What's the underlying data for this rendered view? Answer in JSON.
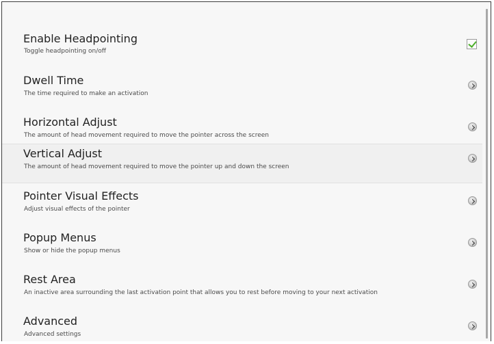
{
  "settings": {
    "items": [
      {
        "title": "Enable Headpointing",
        "summary": "Toggle headpointing on/off",
        "control": "checkbox",
        "checked": true
      },
      {
        "title": "Dwell Time",
        "summary": "The time required to make an activation",
        "control": "chevron-right-icon"
      },
      {
        "title": "Horizontal Adjust",
        "summary": "The amount of head movement required to move the pointer across the screen",
        "control": "chevron-right-icon"
      },
      {
        "title": "Vertical Adjust",
        "summary": "The amount of head movement required to move the pointer up and down the screen",
        "control": "chevron-right-icon"
      },
      {
        "title": "Pointer Visual Effects",
        "summary": "Adjust visual effects of the pointer",
        "control": "chevron-right-icon"
      },
      {
        "title": "Popup Menus",
        "summary": "Show or hide the popup menus",
        "control": "chevron-right-icon"
      },
      {
        "title": "Rest Area",
        "summary": "An inactive area surrounding the last activation point that allows you to rest before moving to your next activation",
        "control": "chevron-right-icon"
      },
      {
        "title": "Advanced",
        "summary": "Advanced settings",
        "control": "chevron-right-icon"
      }
    ]
  },
  "colors": {
    "background": "#f7f7f7",
    "checkmark": "#4caf2a",
    "title_text": "#222222",
    "summary_text": "#4a4a4a"
  }
}
